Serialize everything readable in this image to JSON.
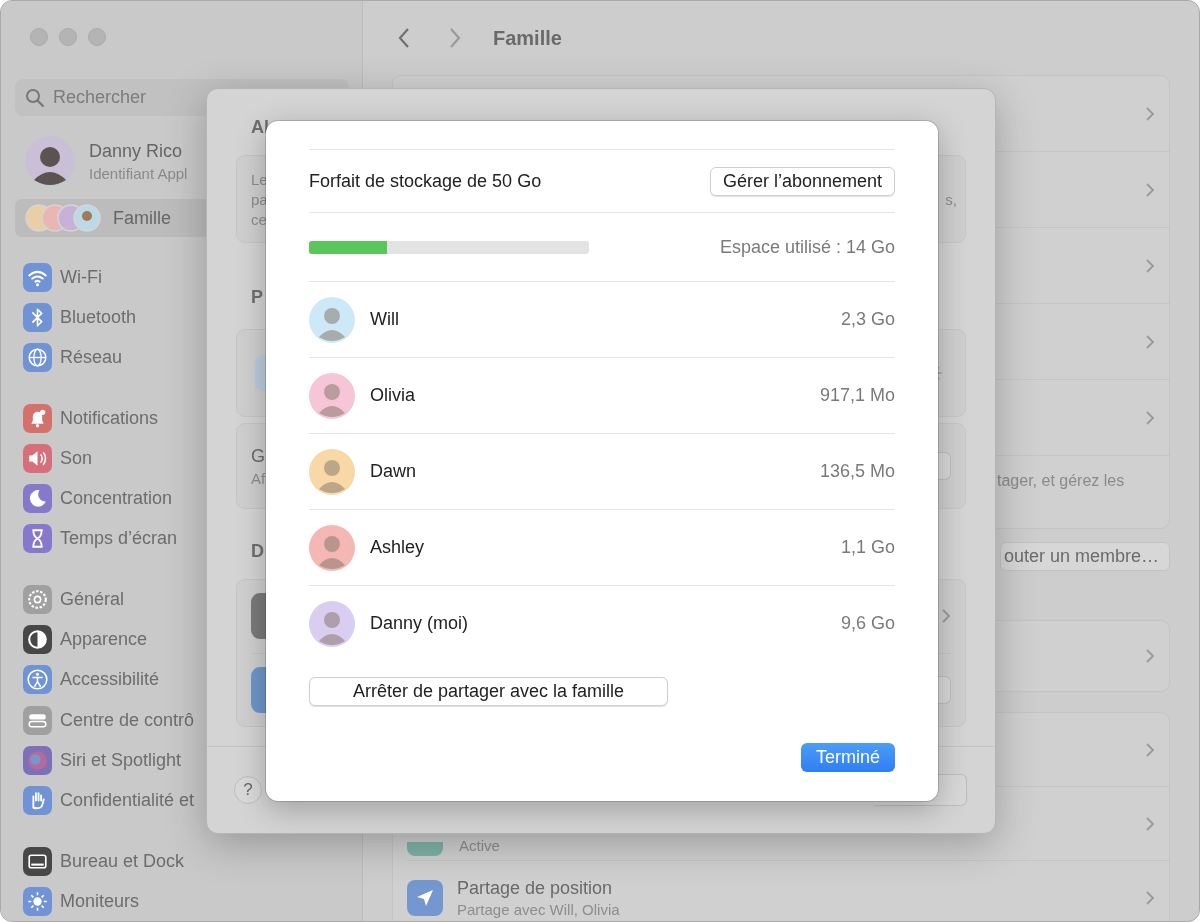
{
  "sidebar": {
    "search": {
      "placeholder": "Rechercher"
    },
    "profile": {
      "name": "Danny Rico",
      "subtitle": "Identifiant Appl"
    },
    "family_item": {
      "label": "Famille",
      "selected": true
    },
    "groups": [
      [
        {
          "kind": "wifi",
          "label": "Wi-Fi",
          "selected": false
        },
        {
          "kind": "bluetooth",
          "label": "Bluetooth",
          "selected": false
        },
        {
          "kind": "network",
          "label": "Réseau",
          "selected": false
        }
      ],
      [
        {
          "kind": "notifications",
          "label": "Notifications",
          "selected": false
        },
        {
          "kind": "sound",
          "label": "Son",
          "selected": false
        },
        {
          "kind": "focus",
          "label": "Concentration",
          "selected": false
        },
        {
          "kind": "screen-time",
          "label": "Temps d’écran",
          "selected": false
        }
      ],
      [
        {
          "kind": "general",
          "label": "Général",
          "selected": false
        },
        {
          "kind": "appearance",
          "label": "Apparence",
          "selected": false
        },
        {
          "kind": "accessibility",
          "label": "Accessibilité",
          "selected": false
        },
        {
          "kind": "control-center",
          "label": "Centre de contrô",
          "selected": false
        },
        {
          "kind": "siri",
          "label": "Siri et Spotlight",
          "selected": false
        },
        {
          "kind": "privacy",
          "label": "Confidentialité et",
          "selected": false
        }
      ],
      [
        {
          "kind": "desktop",
          "label": "Bureau et Dock",
          "selected": false
        },
        {
          "kind": "displays",
          "label": "Moniteurs",
          "selected": false
        }
      ]
    ]
  },
  "header": {
    "title": "Famille"
  },
  "main": {
    "description": "tager, et gérez les",
    "add_member_button": "outer un membre…",
    "active_row": {
      "subtitle": "Active"
    },
    "location_row": {
      "title": "Partage de position",
      "subtitle": "Partage avec Will, Olivia"
    }
  },
  "middle_sheet": {
    "title": "Al",
    "intro_lines": [
      "Le",
      "pa",
      "ce"
    ],
    "intro_tail": "s,",
    "section_heading": "P",
    "row_title": "G",
    "row_subtitle": "Af",
    "devices_heading": "D",
    "help_button": "?"
  },
  "storage_sheet": {
    "plan": "Forfait de stockage de 50 Go",
    "manage_button": "Gérer l’abonnement",
    "usage": {
      "level": 0.28,
      "label": "Espace utilisé : 14 Go"
    },
    "members": [
      {
        "name": "Will",
        "size": "2,3 Go",
        "color": "#cde8f7"
      },
      {
        "name": "Olivia",
        "size": "917,1 Mo",
        "color": "#f6c5d8"
      },
      {
        "name": "Dawn",
        "size": "136,5 Mo",
        "color": "#f8d9a6"
      },
      {
        "name": "Ashley",
        "size": "1,1 Go",
        "color": "#f4b7b3"
      },
      {
        "name": "Danny (moi)",
        "size": "9,6 Go",
        "color": "#d9cdf1"
      }
    ],
    "stop_button": "Arrêter de partager avec la famille",
    "done_button": "Terminé"
  }
}
